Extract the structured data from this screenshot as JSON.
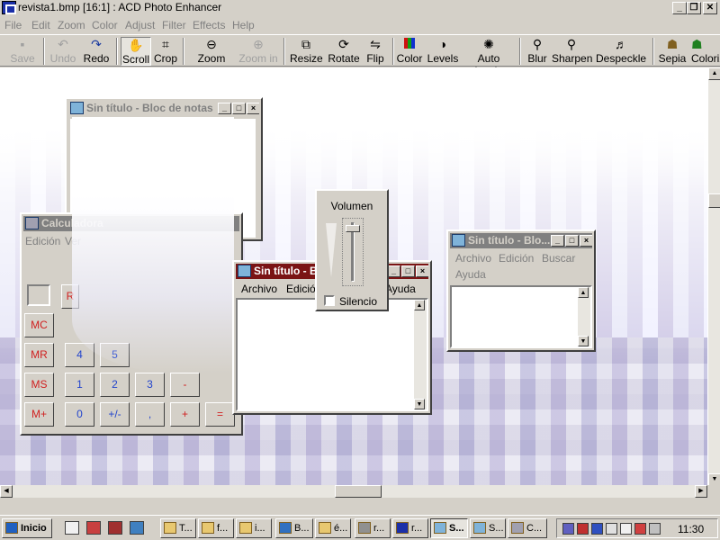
{
  "app": {
    "title": "revista1.bmp [16:1] : ACD Photo Enhancer"
  },
  "menu": [
    "File",
    "Edit",
    "Zoom",
    "Color",
    "Adjust",
    "Filter",
    "Effects",
    "Help"
  ],
  "toolbar": {
    "save": "Save",
    "undo": "Undo",
    "redo": "Redo",
    "scroll": "Scroll",
    "crop": "Crop",
    "zoom_out": "Zoom out",
    "zoom_in": "Zoom in",
    "resize": "Resize",
    "rotate": "Rotate",
    "flip": "Flip",
    "color": "Color",
    "levels": "Levels",
    "auto_levels": "Auto levels",
    "blur": "Blur",
    "sharpen": "Sharpen",
    "despeckle": "Despeckle",
    "sepia": "Sepia",
    "colorize": "Coloriz"
  },
  "notepad_back": {
    "title": "Sin título - Bloc de notas"
  },
  "calculator": {
    "title": "Calculadora",
    "menu": [
      "Edición",
      "Ver"
    ],
    "buttons": [
      {
        "label": "MC",
        "red": true
      },
      {
        "label": "MR",
        "red": true
      },
      {
        "label": "MS",
        "red": true
      },
      {
        "label": "M+",
        "red": true
      },
      {
        "label": "4"
      },
      {
        "label": "5"
      },
      {
        "label": "1"
      },
      {
        "label": "2"
      },
      {
        "label": "3"
      },
      {
        "label": "-"
      },
      {
        "label": "0"
      },
      {
        "label": "+/-"
      },
      {
        "label": ","
      },
      {
        "label": "+"
      },
      {
        "label": "="
      }
    ],
    "partial_red": "R"
  },
  "notepad_active": {
    "title": "Sin título - Bloc de notas",
    "menu": [
      "Archivo",
      "Edición",
      "Ayuda"
    ]
  },
  "notepad_right": {
    "title": "Sin título - Blo...",
    "menu": [
      "Archivo",
      "Edición",
      "Buscar",
      "Ayuda"
    ]
  },
  "volume": {
    "label": "Volumen",
    "mute_label": "Silencio",
    "level": 0.95
  },
  "taskbar": {
    "start": "Inicio",
    "tasks": [
      "T...",
      "f...",
      "i...",
      "B...",
      "é...",
      "r...",
      "r...",
      "S...",
      "S...",
      "C..."
    ],
    "clock": "11:30"
  }
}
